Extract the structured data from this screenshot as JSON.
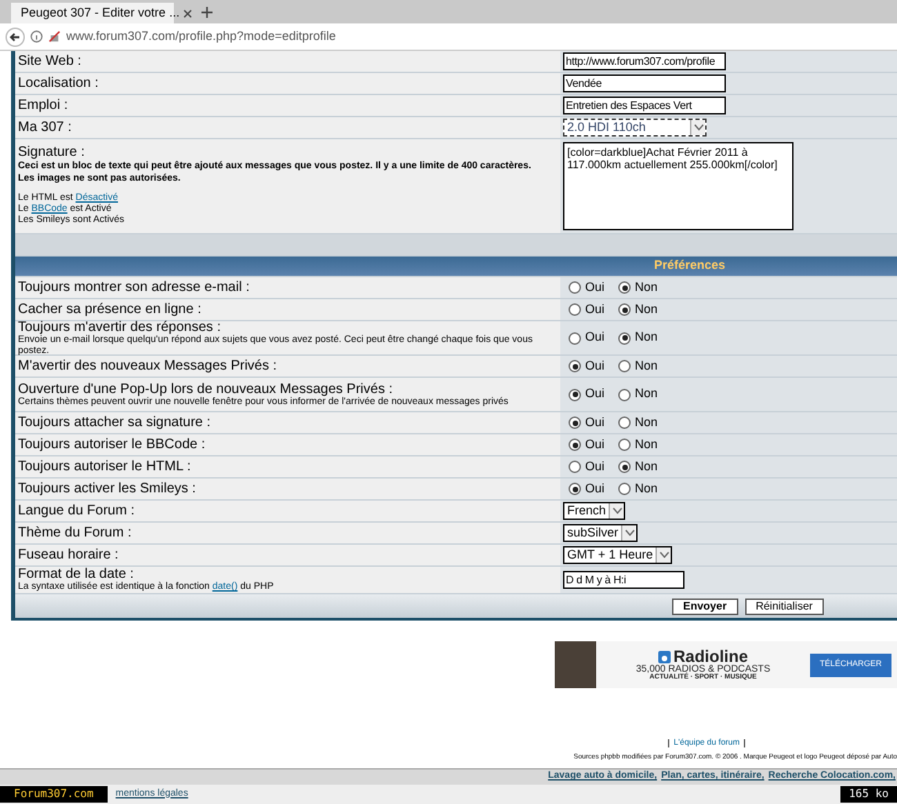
{
  "browser": {
    "tab_title": "Peugeot 307 - Editer votre ...",
    "url": "www.forum307.com/profile.php?mode=editprofile"
  },
  "profile_rows": [
    {
      "label": "Site Web :",
      "kind": "text",
      "value": "http://www.forum307.com/profile"
    },
    {
      "label": "Localisation :",
      "kind": "text",
      "value": "Vendée"
    },
    {
      "label": "Emploi :",
      "kind": "text",
      "value": "Entretien des Espaces Vert"
    },
    {
      "label": "Ma 307 :",
      "kind": "select",
      "value": "2.0 HDI 110ch"
    },
    {
      "label": "Signature :",
      "kind": "textarea",
      "description": "Ceci est un bloc de texte qui peut être ajouté aux messages que vous postez. Il y a une limite de 400 caractères. Les images ne sont pas autorisées.",
      "notes": [
        {
          "before": "Le HTML est ",
          "link": "Désactivé"
        },
        {
          "before": "Le ",
          "link": "BBCode",
          "after": " est Activé"
        },
        {
          "before": "Les Smileys sont Activés"
        }
      ],
      "value": "[color=darkblue]Achat Février 2011 à 117.000km actuellement 255.000km[/color]"
    }
  ],
  "preferences": {
    "header": "Préférences",
    "rows": [
      {
        "kind": "radio",
        "label": "Toujours montrer son adresse e-mail :",
        "options": [
          {
            "label": "Oui",
            "selected": false
          },
          {
            "label": "Non",
            "selected": true
          }
        ]
      },
      {
        "kind": "radio",
        "label": "Cacher sa présence en ligne :",
        "options": [
          {
            "label": "Oui",
            "selected": false
          },
          {
            "label": "Non",
            "selected": true
          }
        ]
      },
      {
        "kind": "radio",
        "label": "Toujours m'avertir des réponses :",
        "description": "Envoie un e-mail lorsque quelqu'un répond aux sujets que vous avez posté. Ceci peut être changé chaque fois que vous postez.",
        "options": [
          {
            "label": "Oui",
            "selected": false
          },
          {
            "label": "Non",
            "selected": true
          }
        ]
      },
      {
        "kind": "radio",
        "label": "M'avertir des nouveaux Messages Privés :",
        "options": [
          {
            "label": "Oui",
            "selected": true
          },
          {
            "label": "Non",
            "selected": false
          }
        ]
      },
      {
        "kind": "radio",
        "label": "Ouverture d'une Pop-Up lors de nouveaux Messages Privés :",
        "description": "Certains thèmes peuvent ouvrir une nouvelle fenêtre pour vous informer de l'arrivée de nouveaux messages privés",
        "options": [
          {
            "label": "Oui",
            "selected": true
          },
          {
            "label": "Non",
            "selected": false
          }
        ]
      },
      {
        "kind": "radio",
        "label": "Toujours attacher sa signature :",
        "options": [
          {
            "label": "Oui",
            "selected": true
          },
          {
            "label": "Non",
            "selected": false
          }
        ]
      },
      {
        "kind": "radio",
        "label": "Toujours autoriser le BBCode :",
        "options": [
          {
            "label": "Oui",
            "selected": true
          },
          {
            "label": "Non",
            "selected": false
          }
        ]
      },
      {
        "kind": "radio",
        "label": "Toujours autoriser le HTML :",
        "options": [
          {
            "label": "Oui",
            "selected": false
          },
          {
            "label": "Non",
            "selected": true
          }
        ]
      },
      {
        "kind": "radio",
        "label": "Toujours activer les Smileys :",
        "options": [
          {
            "label": "Oui",
            "selected": true
          },
          {
            "label": "Non",
            "selected": false
          }
        ]
      },
      {
        "kind": "select",
        "label": "Langue du Forum :",
        "value": "French"
      },
      {
        "kind": "select",
        "label": "Thème du Forum :",
        "value": "subSilver"
      },
      {
        "kind": "select",
        "label": "Fuseau horaire :",
        "value": "GMT + 1 Heure"
      },
      {
        "kind": "text",
        "label": "Format de la date :",
        "note": {
          "before": "La syntaxe utilisée est identique à la fonction ",
          "link": "date()",
          "after": " du PHP"
        },
        "value": "D d M y à H:i"
      }
    ],
    "buttons": [
      "Envoyer",
      "Réinitialiser"
    ]
  },
  "ad": {
    "brand": "Radioline",
    "headline": "35,000  RADIOS & PODCASTS",
    "tagline": "ACTUALITÉ · SPORT · MUSIQUE",
    "button": "TÉLÉCHARGER"
  },
  "footer": {
    "team_link": "L'équipe du forum",
    "credits": "Sources phpbb modifiées par Forum307.com. © 2006 . Marque Peugeot et logo Peugeot déposé par Auto",
    "links": [
      "Lavage auto à domicile,",
      "Plan, cartes, itinéraire,",
      "Recherche Colocation.com,"
    ],
    "bottom_link": "mentions légales"
  },
  "status_bar": {
    "left": "Forum307.com",
    "right": "165 ko"
  }
}
